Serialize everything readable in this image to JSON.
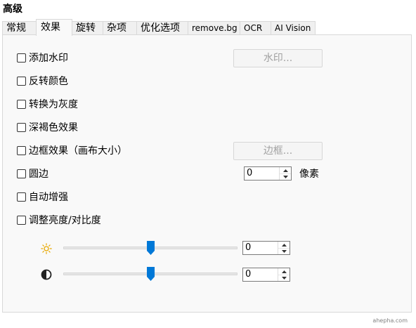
{
  "section_title": "高级",
  "tabs": [
    {
      "label": "常规"
    },
    {
      "label": "效果",
      "active": true
    },
    {
      "label": "旋转"
    },
    {
      "label": "杂项"
    },
    {
      "label": "优化选项"
    },
    {
      "label": "remove.bg"
    },
    {
      "label": "OCR"
    },
    {
      "label": "AI Vision"
    }
  ],
  "effects": {
    "add_watermark": {
      "label": "添加水印",
      "checked": false
    },
    "invert_colors": {
      "label": "反转颜色",
      "checked": false
    },
    "grayscale": {
      "label": "转换为灰度",
      "checked": false
    },
    "sepia": {
      "label": "深褐色效果",
      "checked": false
    },
    "border_effect": {
      "label": "边框效果（画布大小）",
      "checked": false
    },
    "round_corners": {
      "label": "圆边",
      "checked": false
    },
    "auto_enhance": {
      "label": "自动增强",
      "checked": false
    },
    "brightness_contrast": {
      "label": "调整亮度/对比度",
      "checked": false
    }
  },
  "buttons": {
    "watermark": "水印...",
    "border": "边框..."
  },
  "round_corners_radius": {
    "value": "0",
    "unit": "像素"
  },
  "brightness": {
    "icon": "sun-icon",
    "value": "0",
    "slider_position": 0.5
  },
  "contrast": {
    "icon": "contrast-icon",
    "value": "0",
    "slider_position": 0.5
  },
  "watermark_text": "ahepha.com",
  "colors": {
    "accent": "#0078d7",
    "panel_bg": "#f9f9f9",
    "border": "#d9d9d9",
    "disabled_text": "#a0a0a0",
    "sun": "#e8a800"
  }
}
